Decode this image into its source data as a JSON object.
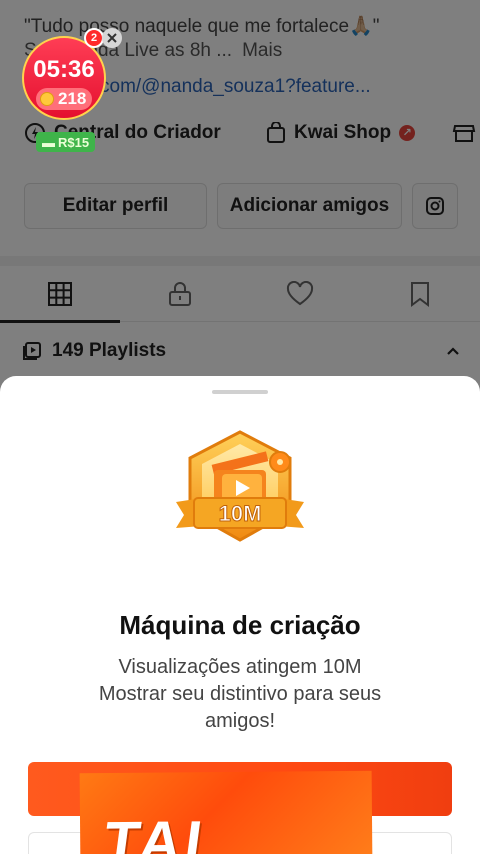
{
  "profile": {
    "bio_line1": "\"Tudo posso naquele que me fortalece🙏🏼\"",
    "bio_line2": "Sou Nanda Live as 8h ...",
    "bio_more": "Mais",
    "link_text": "com/@nanda_souza1?feature...",
    "creator_center_label": "Central do Criador",
    "shop_label": "Kwai Shop",
    "edit_profile_label": "Editar perfil",
    "add_friends_label": "Adicionar amigos",
    "playlists_label": "149 Playlists"
  },
  "live_widget": {
    "time": "05:36",
    "notification_count": "2",
    "coins": "218",
    "cash": "R$15"
  },
  "sheet": {
    "badge_label": "10M",
    "title": "Máquina de criação",
    "desc_line1": "Visualizações atingem 10M",
    "desc_line2": "Mostrar seu distintivo para seus",
    "desc_line3": "amigos!",
    "promo_text": "TAL"
  },
  "colors": {
    "accent": "#ff5a1e",
    "badge_gold": "#f7a21b",
    "link_blue": "#2a63b7",
    "live_red": "#e4102f"
  }
}
